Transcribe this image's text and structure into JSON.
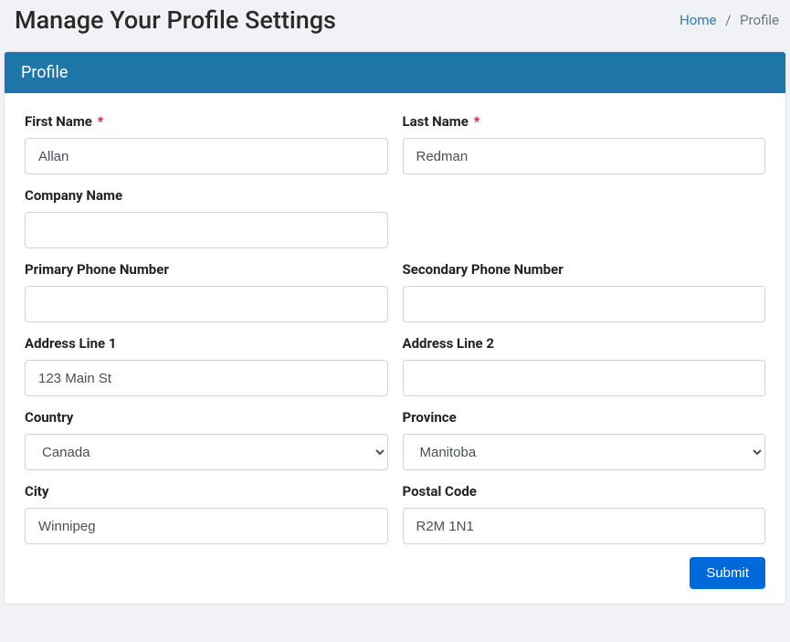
{
  "header": {
    "title": "Manage Your Profile Settings"
  },
  "breadcrumb": {
    "home": "Home",
    "current": "Profile",
    "separator": "/"
  },
  "panel": {
    "title": "Profile"
  },
  "form": {
    "first_name": {
      "label": "First Name",
      "value": "Allan"
    },
    "last_name": {
      "label": "Last Name",
      "value": "Redman"
    },
    "company_name": {
      "label": "Company Name",
      "value": ""
    },
    "primary_phone": {
      "label": "Primary Phone Number",
      "value": ""
    },
    "secondary_phone": {
      "label": "Secondary Phone Number",
      "value": ""
    },
    "address1": {
      "label": "Address Line 1",
      "value": "123 Main St"
    },
    "address2": {
      "label": "Address Line 2",
      "value": ""
    },
    "country": {
      "label": "Country",
      "value": "Canada"
    },
    "province": {
      "label": "Province",
      "value": "Manitoba"
    },
    "city": {
      "label": "City",
      "value": "Winnipeg"
    },
    "postal_code": {
      "label": "Postal Code",
      "value": "R2M 1N1"
    },
    "submit": "Submit",
    "required_marker": "*"
  }
}
